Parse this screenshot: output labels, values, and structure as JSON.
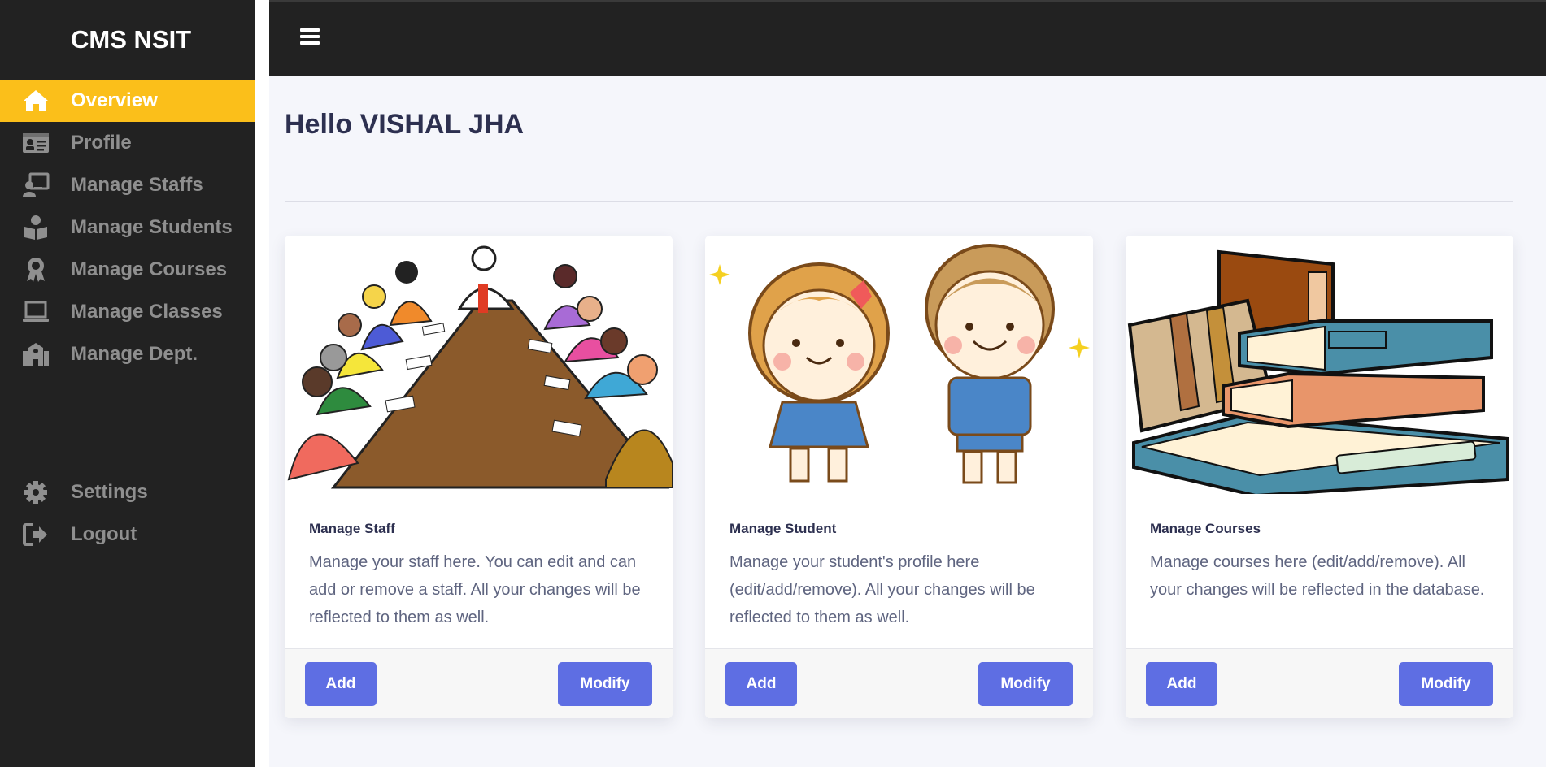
{
  "sidebar": {
    "brand": "CMS NSIT",
    "items": [
      {
        "label": "Overview",
        "icon": "home-icon"
      },
      {
        "label": "Profile",
        "icon": "id-card-icon"
      },
      {
        "label": "Manage Staffs",
        "icon": "teacher-icon"
      },
      {
        "label": "Manage Students",
        "icon": "student-icon"
      },
      {
        "label": "Manage Courses",
        "icon": "award-icon"
      },
      {
        "label": "Manage Classes",
        "icon": "laptop-icon"
      },
      {
        "label": "Manage Dept.",
        "icon": "school-icon"
      }
    ],
    "bottom_items": [
      {
        "label": "Settings",
        "icon": "gear-icon"
      },
      {
        "label": "Logout",
        "icon": "logout-icon"
      }
    ]
  },
  "main": {
    "greeting": "Hello VISHAL JHA",
    "cards": [
      {
        "title": "Manage Staff",
        "text": "Manage your staff here. You can edit and can add or remove a staff. All your changes will be reflected to them as well.",
        "add_label": "Add",
        "modify_label": "Modify"
      },
      {
        "title": "Manage Student",
        "text": "Manage your student's profile here (edit/add/remove). All your changes will be reflected to them as well.",
        "add_label": "Add",
        "modify_label": "Modify"
      },
      {
        "title": "Manage Courses",
        "text": "Manage courses here (edit/add/remove). All your changes will be reflected in the database.",
        "add_label": "Add",
        "modify_label": "Modify"
      }
    ]
  },
  "colors": {
    "sidebar_bg": "#222222",
    "active_item": "#fbbf1a",
    "button": "#5e6ee3",
    "main_bg": "#f5f6fb",
    "heading": "#2d3050"
  }
}
